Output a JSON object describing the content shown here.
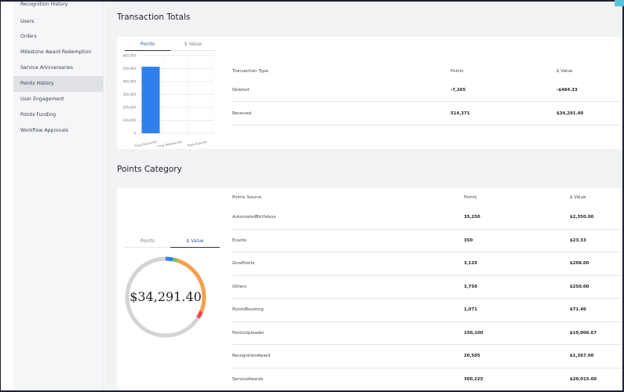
{
  "sidebar": {
    "items": [
      {
        "label": "Recognition History",
        "active": false
      },
      {
        "label": "Users",
        "active": false
      },
      {
        "label": "Orders",
        "active": false
      },
      {
        "label": "Milestone Award Redemption",
        "active": false
      },
      {
        "label": "Service Anniversaries",
        "active": false
      },
      {
        "label": "Points History",
        "active": true
      },
      {
        "label": "User Engagement",
        "active": false
      },
      {
        "label": "Points Funding",
        "active": false
      },
      {
        "label": "Workflow Approvals",
        "active": false
      }
    ]
  },
  "transaction_totals": {
    "title": "Transaction Totals",
    "tabs": [
      "Points",
      "$ Value"
    ],
    "active_tab": "Points",
    "table": {
      "headers": [
        "Transaction Type",
        "Points",
        "$ Value"
      ],
      "rows": [
        [
          "Deleted",
          "-7,265",
          "-$484.33"
        ],
        [
          "Received",
          "514,371",
          "$34,291.40"
        ]
      ]
    }
  },
  "chart_data": {
    "type": "bar",
    "categories": [
      "Total Received",
      "Total Redeemed",
      "Total Expired"
    ],
    "values": [
      514371,
      0,
      0
    ],
    "ylim": [
      0,
      600000
    ],
    "y_ticks": [
      "600,000",
      "500,000",
      "400,000",
      "300,000",
      "200,000",
      "100,000",
      "0"
    ],
    "bar_color": "#2f80ed",
    "grid": true
  },
  "points_category": {
    "title": "Points Category",
    "tabs": [
      "Points",
      "$ Value"
    ],
    "active_tab": "$ Value",
    "donut_value": "$34,291.40",
    "donut_segments": [
      {
        "fraction": 0.03,
        "color": "#2f80ed"
      },
      {
        "fraction": 0.02,
        "color": "#7fbf5f"
      },
      {
        "fraction": 0.26,
        "color": "#f5a04a"
      },
      {
        "fraction": 0.03,
        "color": "#e8494b"
      },
      {
        "fraction": 0.66,
        "color": "#d3d4d7"
      }
    ],
    "table": {
      "headers": [
        "Points Source",
        "Points",
        "$ Value"
      ],
      "rows": [
        [
          "AutomatedBirthdays",
          "35,250",
          "$2,350.00"
        ],
        [
          "Ecards",
          "350",
          "$23.33"
        ],
        [
          "GivePoints",
          "3,120",
          "$208.00"
        ],
        [
          "Others",
          "3,750",
          "$250.00"
        ],
        [
          "PointsBoosting",
          "1,071",
          "$71.40"
        ],
        [
          "PointsUploader",
          "150,100",
          "$10,006.67"
        ],
        [
          "RecognitionAward",
          "20,505",
          "$1,367.00"
        ],
        [
          "ServiceAwards",
          "300,225",
          "$20,015.00"
        ]
      ]
    }
  }
}
